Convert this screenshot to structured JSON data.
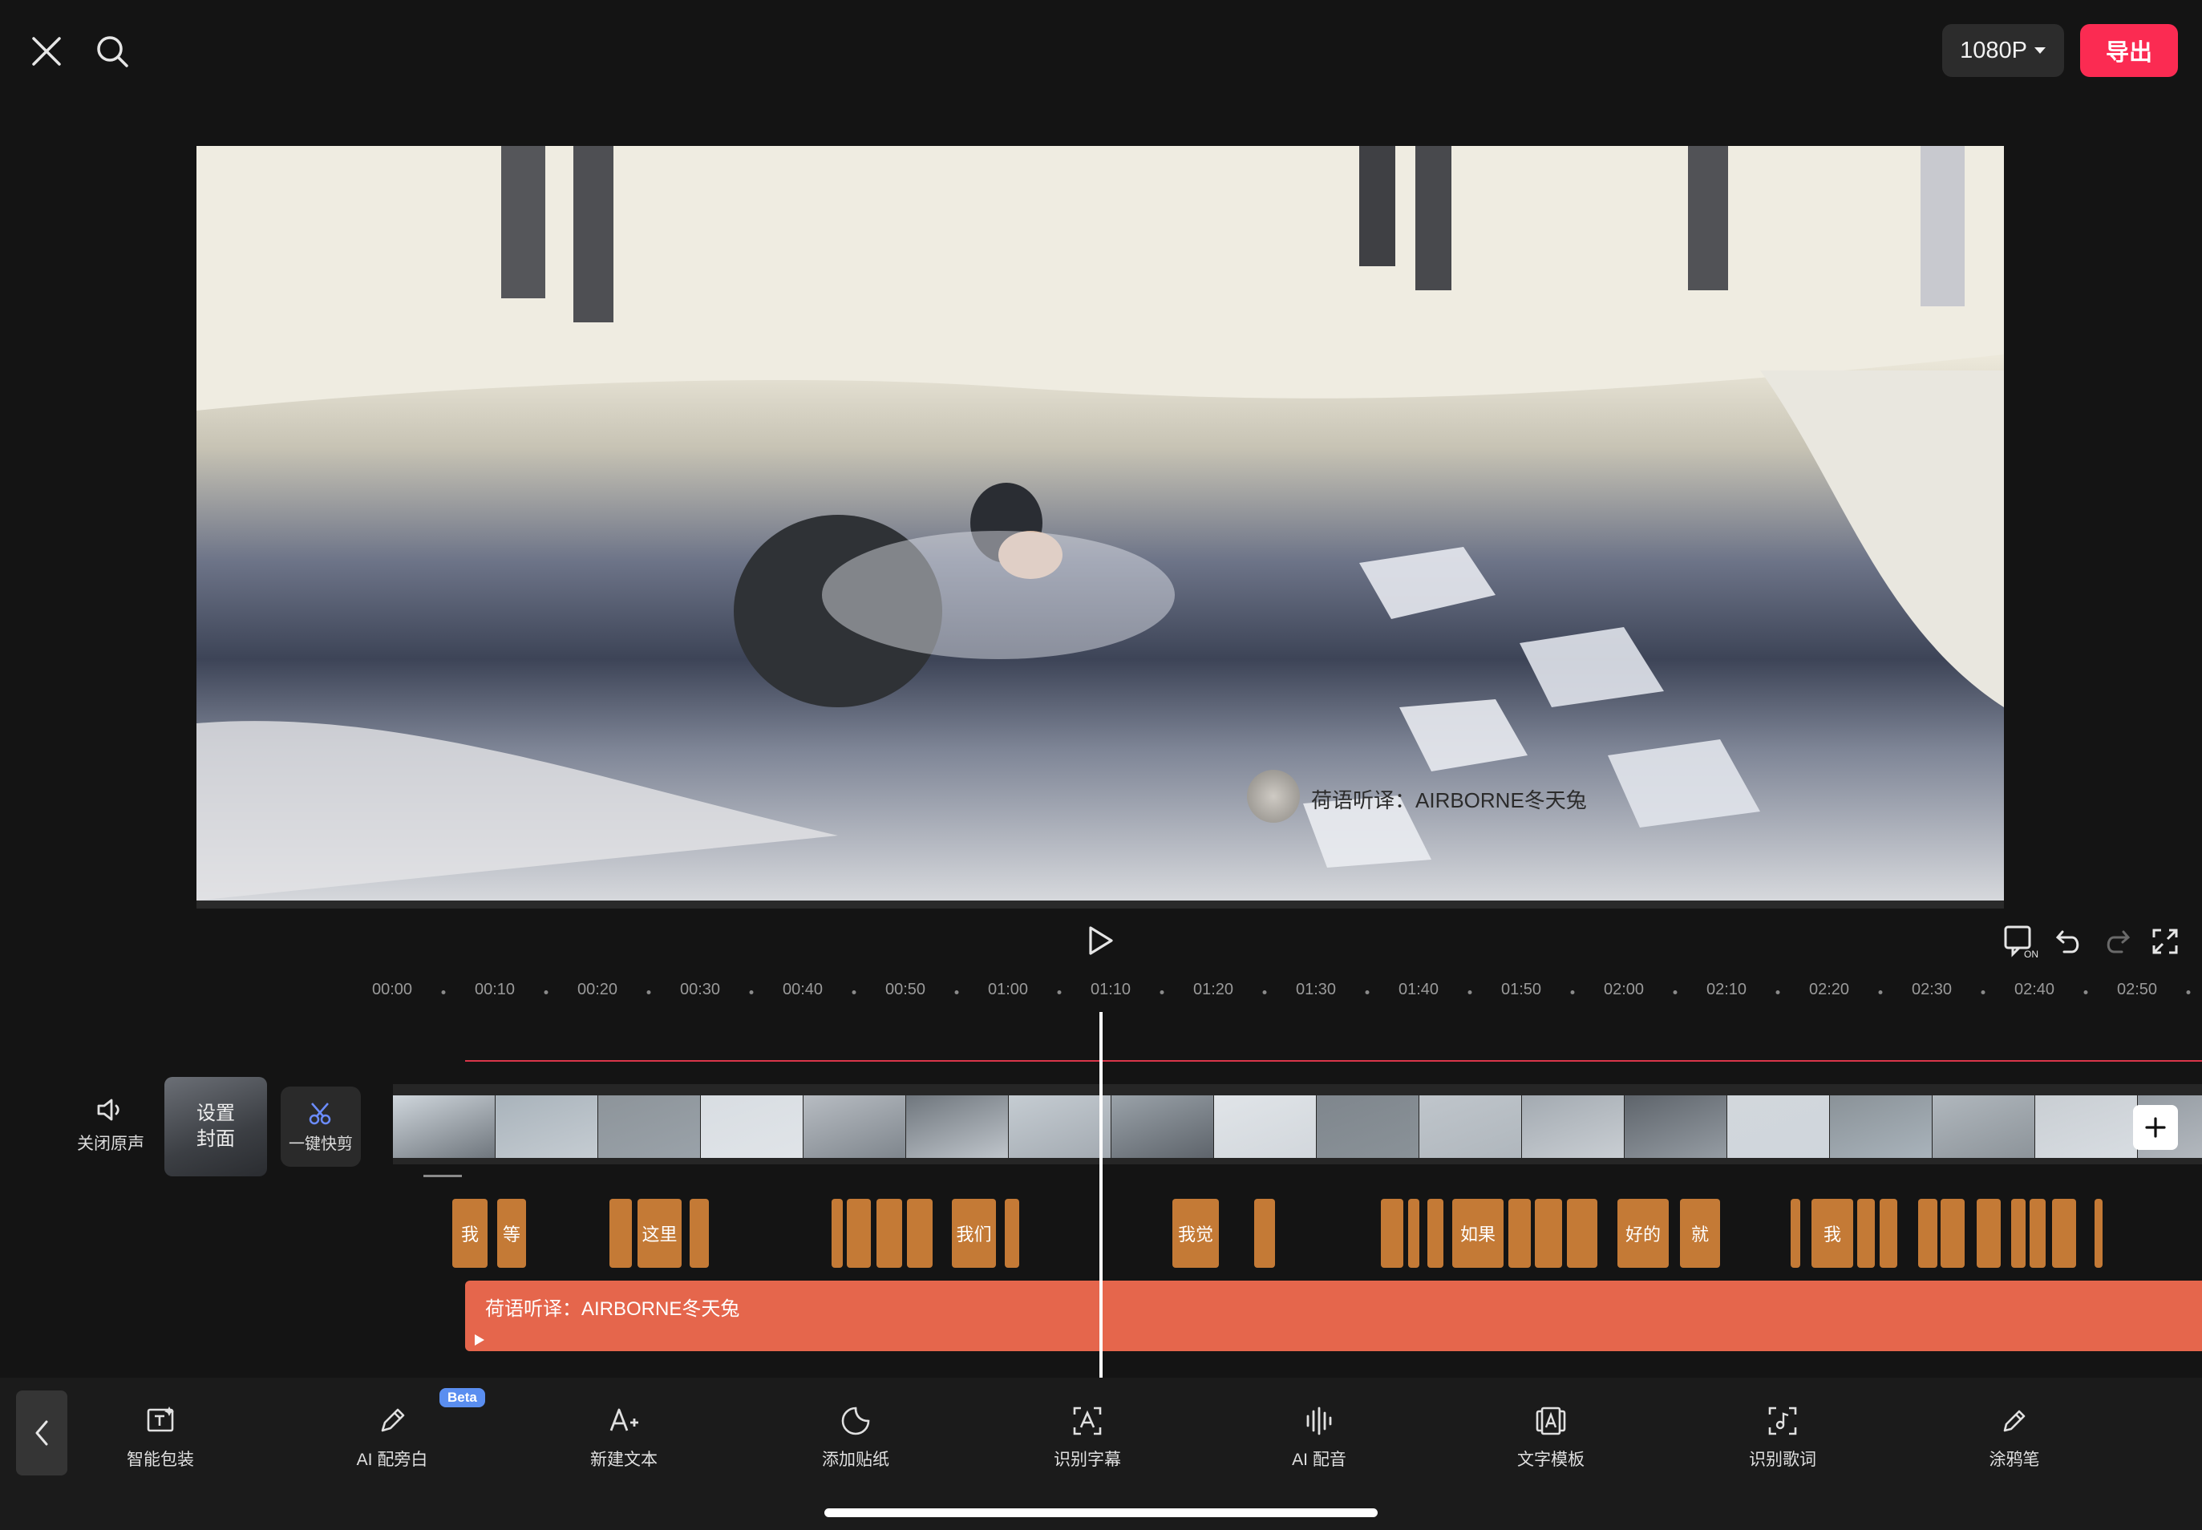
{
  "topbar": {
    "resolution": "1080P",
    "export_label": "导出"
  },
  "video": {
    "watermark": "荷语听译：AIRBORNE冬天兔"
  },
  "ruler": {
    "ticks": [
      "00:00",
      "00:10",
      "00:20",
      "00:30",
      "00:40",
      "00:50",
      "01:00",
      "01:10",
      "01:20",
      "01:30",
      "01:40",
      "01:50",
      "02:00",
      "02:10",
      "02:20",
      "02:30",
      "02:40",
      "02:50"
    ]
  },
  "left_tools": {
    "mute_label": "关闭原声",
    "cover_line1": "设置",
    "cover_line2": "封面",
    "quickcut_label": "一键快剪"
  },
  "subtitle_clips": [
    "我",
    "等",
    "这里",
    "我们",
    "我觉",
    "如果",
    "好的",
    "就",
    "我"
  ],
  "text_track": {
    "label": "荷语听译：AIRBORNE冬天兔"
  },
  "toolbar": {
    "items": [
      {
        "label": "智能包装",
        "icon": "smart-package-icon"
      },
      {
        "label": "AI 配旁白",
        "icon": "ai-narration-icon",
        "badge": "Beta"
      },
      {
        "label": "新建文本",
        "icon": "new-text-icon"
      },
      {
        "label": "添加贴纸",
        "icon": "sticker-icon"
      },
      {
        "label": "识别字幕",
        "icon": "recognize-subtitle-icon"
      },
      {
        "label": "AI 配音",
        "icon": "ai-voice-icon"
      },
      {
        "label": "文字模板",
        "icon": "text-template-icon"
      },
      {
        "label": "识别歌词",
        "icon": "recognize-lyrics-icon"
      },
      {
        "label": "涂鸦笔",
        "icon": "doodle-pen-icon"
      }
    ]
  },
  "colors": {
    "accent": "#fb2b52",
    "subtitle_clip": "#c47a36",
    "text_track": "#e5664c"
  }
}
